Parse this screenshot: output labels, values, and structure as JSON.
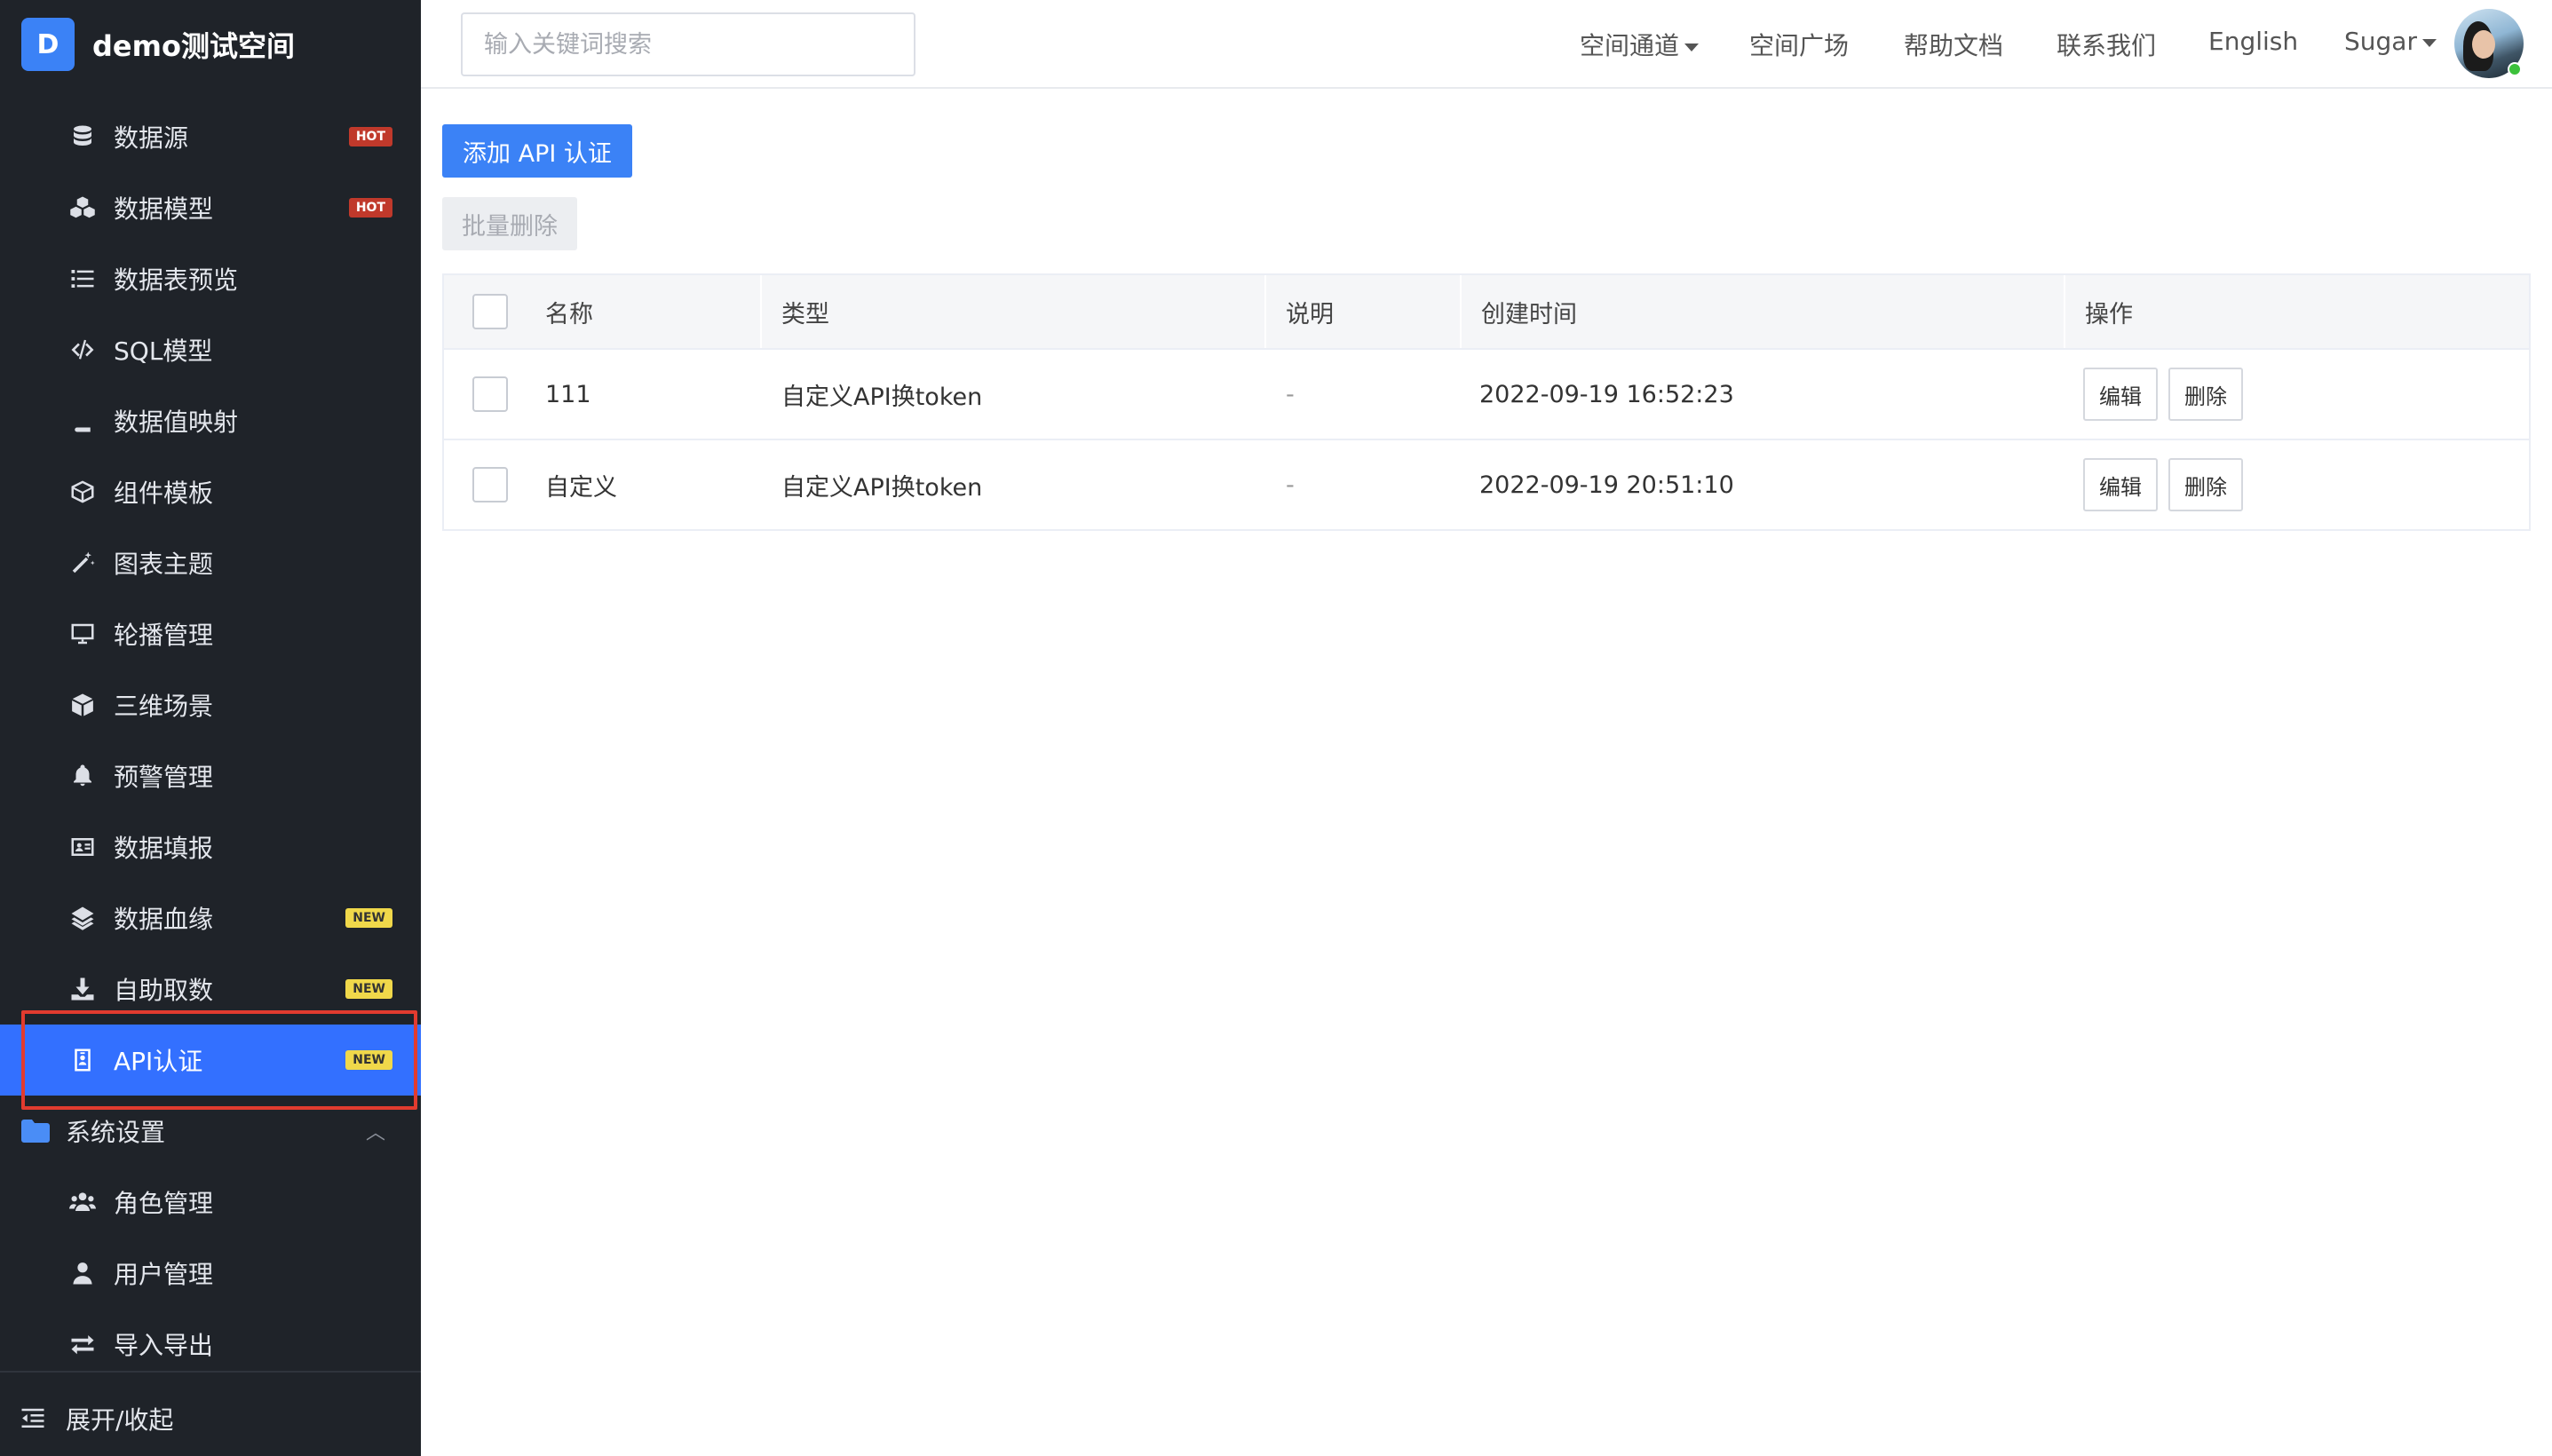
{
  "brand": {
    "logo_letter": "D",
    "name": "demo测试空间"
  },
  "sidebar": {
    "items": [
      {
        "label": "数据源",
        "icon": "database-icon",
        "badge": "HOT"
      },
      {
        "label": "数据模型",
        "icon": "cubes-icon",
        "badge": "HOT"
      },
      {
        "label": "数据表预览",
        "icon": "list-icon",
        "badge": ""
      },
      {
        "label": "SQL模型",
        "icon": "code-icon",
        "badge": ""
      },
      {
        "label": "数据值映射",
        "icon": "book-icon",
        "badge": ""
      },
      {
        "label": "组件模板",
        "icon": "cube-outline-icon",
        "badge": ""
      },
      {
        "label": "图表主题",
        "icon": "magic-wand-icon",
        "badge": ""
      },
      {
        "label": "轮播管理",
        "icon": "monitor-icon",
        "badge": ""
      },
      {
        "label": "三维场景",
        "icon": "cube-solid-icon",
        "badge": ""
      },
      {
        "label": "预警管理",
        "icon": "bell-icon",
        "badge": ""
      },
      {
        "label": "数据填报",
        "icon": "id-card-icon",
        "badge": ""
      },
      {
        "label": "数据血缘",
        "icon": "layers-icon",
        "badge": "NEW"
      },
      {
        "label": "自助取数",
        "icon": "download-icon",
        "badge": "NEW"
      },
      {
        "label": "API认证",
        "icon": "id-badge-icon",
        "badge": "NEW",
        "active": true
      }
    ],
    "group": {
      "label": "系统设置",
      "icon": "folder-icon",
      "expanded": true
    },
    "group_items": [
      {
        "label": "角色管理",
        "icon": "users-icon"
      },
      {
        "label": "用户管理",
        "icon": "user-icon"
      },
      {
        "label": "导入导出",
        "icon": "exchange-icon"
      }
    ],
    "collapse_label": "展开/收起",
    "colors": {
      "background": "#1f2329",
      "active": "#3370ff",
      "hot": "#c0392b",
      "new": "#f0d84a",
      "highlight": "#e23b2f"
    }
  },
  "header": {
    "search_placeholder": "输入关键词搜索",
    "links": [
      "空间通道",
      "空间广场",
      "帮助文档",
      "联系我们",
      "English"
    ],
    "user": "Sugar"
  },
  "main": {
    "add_button": "添加 API 认证",
    "batch_delete_button": "批量删除",
    "table": {
      "columns": [
        "名称",
        "类型",
        "说明",
        "创建时间",
        "操作"
      ],
      "rows": [
        {
          "name": "111",
          "type": "自定义API换token",
          "desc": "-",
          "created": "2022-09-19 16:52:23",
          "edit": "编辑",
          "delete": "删除"
        },
        {
          "name": "自定义",
          "type": "自定义API换token",
          "desc": "-",
          "created": "2022-09-19 20:51:10",
          "edit": "编辑",
          "delete": "删除"
        }
      ]
    }
  }
}
